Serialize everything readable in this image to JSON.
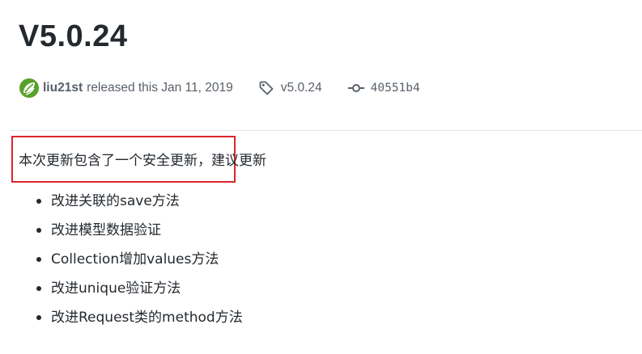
{
  "release": {
    "title": "V5.0.24",
    "author": "liu21st",
    "released_text": "released this Jan 11, 2019",
    "tag": "v5.0.24",
    "commit": "40551b4"
  },
  "body": {
    "summary_highlighted": "本次更新包含了一个安全更新",
    "summary_rest": "，建议更新",
    "items": [
      "改进关联的save方法",
      "改进模型数据验证",
      "Collection增加values方法",
      "改进unique验证方法",
      "改进Request类的method方法"
    ]
  },
  "icons": {
    "avatar": "avatar-leaf-logo",
    "tag": "tag-icon",
    "commit": "git-commit-icon"
  },
  "colors": {
    "highlight_border": "#d9262b",
    "muted_text": "#586069",
    "body_text": "#24292e",
    "avatar_green": "#4c9a2a"
  }
}
